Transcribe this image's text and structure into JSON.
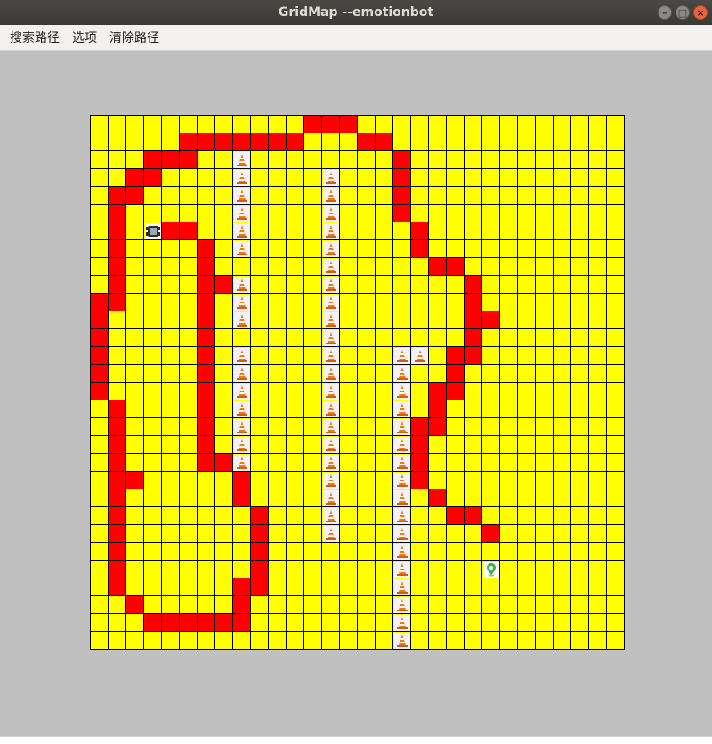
{
  "window": {
    "title": "GridMap --emotionbot"
  },
  "menu": [
    {
      "id": "search",
      "label": "搜索路径"
    },
    {
      "id": "options",
      "label": "选项"
    },
    {
      "id": "clear",
      "label": "清除路径"
    }
  ],
  "colors": {
    "free": "#ffff00",
    "path": "#ff0000",
    "grid_line": "#000000",
    "background": "#c0c0c0"
  },
  "grid": {
    "cols": 30,
    "rows": 30,
    "start": [
      3,
      6
    ],
    "goal": [
      22,
      25
    ],
    "path": [
      [
        0,
        12
      ],
      [
        0,
        13
      ],
      [
        0,
        14
      ],
      [
        1,
        10
      ],
      [
        1,
        11
      ],
      [
        1,
        12
      ],
      [
        1,
        13
      ],
      [
        1,
        14
      ],
      [
        1,
        15
      ],
      [
        1,
        16
      ],
      [
        1,
        17
      ],
      [
        1,
        18
      ],
      [
        1,
        19
      ],
      [
        1,
        20
      ],
      [
        1,
        21
      ],
      [
        1,
        22
      ],
      [
        1,
        23
      ],
      [
        1,
        24
      ],
      [
        1,
        25
      ],
      [
        1,
        26
      ],
      [
        1,
        27
      ],
      [
        1,
        28
      ],
      [
        1,
        29
      ],
      [
        1,
        30
      ],
      [
        1,
        31
      ],
      [
        1,
        32
      ],
      [
        1,
        33
      ],
      [
        1,
        34
      ],
      [
        1,
        35
      ],
      [
        1,
        36
      ],
      [
        1,
        37
      ],
      [
        1,
        38
      ],
      [
        1,
        39
      ],
      [
        1,
        40
      ],
      [
        1,
        41
      ],
      [
        1,
        42
      ],
      [
        1,
        43
      ],
      [
        1,
        44
      ],
      [
        1,
        45
      ],
      [
        1,
        46
      ],
      [
        1,
        47
      ],
      [
        1,
        48
      ],
      [
        1,
        49
      ],
      [
        1,
        50
      ],
      [
        1,
        51
      ],
      [
        1,
        52
      ],
      [
        1,
        53
      ],
      [
        1,
        54
      ],
      [
        1,
        55
      ],
      [
        1,
        56
      ],
      [
        1,
        57
      ],
      [
        1,
        58
      ],
      [
        1,
        59
      ],
      [
        1,
        60
      ],
      [
        1,
        61
      ],
      [
        1,
        62
      ],
      [
        1,
        63
      ],
      [
        1,
        64
      ],
      [
        1,
        65
      ],
      [
        1,
        66
      ],
      [
        1,
        67
      ],
      [
        1,
        68
      ],
      [
        1,
        69
      ],
      [
        1,
        70
      ],
      [
        1,
        71
      ],
      [
        1,
        72
      ],
      [
        1,
        73
      ],
      [
        1,
        74
      ],
      [
        1,
        75
      ],
      [
        1,
        76
      ],
      [
        1,
        77
      ],
      [
        1,
        78
      ],
      [
        1,
        79
      ],
      [
        1,
        80
      ],
      [
        1,
        81
      ],
      [
        1,
        82
      ],
      [
        1,
        83
      ],
      [
        1,
        84
      ],
      [
        1,
        85
      ],
      [
        1,
        86
      ],
      [
        1,
        87
      ],
      [
        1,
        88
      ],
      [
        1,
        89
      ],
      [
        1,
        90
      ],
      [
        1,
        91
      ],
      [
        1,
        92
      ],
      [
        1,
        93
      ],
      [
        1,
        94
      ],
      [
        1,
        95
      ],
      [
        1,
        96
      ],
      [
        1,
        97
      ],
      [
        1,
        98
      ],
      [
        1,
        99
      ],
      [
        1,
        100
      ]
    ],
    "path_cells": [
      [
        12,
        0
      ],
      [
        13,
        0
      ],
      [
        14,
        0
      ],
      [
        5,
        1
      ],
      [
        6,
        1
      ],
      [
        7,
        1
      ],
      [
        8,
        1
      ],
      [
        9,
        1
      ],
      [
        10,
        1
      ],
      [
        11,
        1
      ],
      [
        15,
        1
      ],
      [
        16,
        1
      ],
      [
        3,
        2
      ],
      [
        4,
        2
      ],
      [
        5,
        2
      ],
      [
        17,
        2
      ],
      [
        2,
        3
      ],
      [
        3,
        3
      ],
      [
        17,
        3
      ],
      [
        1,
        4
      ],
      [
        2,
        4
      ],
      [
        17,
        4
      ],
      [
        1,
        5
      ],
      [
        17,
        5
      ],
      [
        1,
        6
      ],
      [
        4,
        6
      ],
      [
        5,
        6
      ],
      [
        18,
        6
      ],
      [
        1,
        7
      ],
      [
        6,
        7
      ],
      [
        18,
        7
      ],
      [
        1,
        8
      ],
      [
        6,
        8
      ],
      [
        19,
        8
      ],
      [
        20,
        8
      ],
      [
        1,
        9
      ],
      [
        6,
        9
      ],
      [
        7,
        9
      ],
      [
        21,
        9
      ],
      [
        0,
        10
      ],
      [
        1,
        10
      ],
      [
        6,
        10
      ],
      [
        21,
        10
      ],
      [
        0,
        11
      ],
      [
        6,
        11
      ],
      [
        21,
        11
      ],
      [
        22,
        11
      ],
      [
        0,
        12
      ],
      [
        6,
        12
      ],
      [
        21,
        12
      ],
      [
        0,
        13
      ],
      [
        6,
        13
      ],
      [
        20,
        13
      ],
      [
        21,
        13
      ],
      [
        0,
        14
      ],
      [
        6,
        14
      ],
      [
        20,
        14
      ],
      [
        0,
        15
      ],
      [
        6,
        15
      ],
      [
        19,
        15
      ],
      [
        20,
        15
      ],
      [
        1,
        16
      ],
      [
        6,
        16
      ],
      [
        19,
        16
      ],
      [
        1,
        17
      ],
      [
        6,
        17
      ],
      [
        18,
        17
      ],
      [
        19,
        17
      ],
      [
        1,
        18
      ],
      [
        6,
        18
      ],
      [
        18,
        18
      ],
      [
        1,
        19
      ],
      [
        6,
        19
      ],
      [
        7,
        19
      ],
      [
        18,
        19
      ],
      [
        1,
        20
      ],
      [
        2,
        20
      ],
      [
        8,
        20
      ],
      [
        18,
        20
      ],
      [
        1,
        21
      ],
      [
        8,
        21
      ],
      [
        19,
        21
      ],
      [
        1,
        22
      ],
      [
        9,
        22
      ],
      [
        20,
        22
      ],
      [
        21,
        22
      ],
      [
        1,
        23
      ],
      [
        9,
        23
      ],
      [
        22,
        23
      ],
      [
        1,
        24
      ],
      [
        9,
        24
      ],
      [
        1,
        25
      ],
      [
        9,
        25
      ],
      [
        1,
        26
      ],
      [
        8,
        26
      ],
      [
        9,
        26
      ],
      [
        2,
        27
      ],
      [
        8,
        27
      ],
      [
        3,
        28
      ],
      [
        4,
        28
      ],
      [
        5,
        28
      ],
      [
        6,
        28
      ],
      [
        7,
        28
      ],
      [
        8,
        28
      ]
    ],
    "obstacles": [
      [
        8,
        2
      ],
      [
        8,
        3
      ],
      [
        8,
        4
      ],
      [
        8,
        5
      ],
      [
        8,
        6
      ],
      [
        8,
        7
      ],
      [
        8,
        9
      ],
      [
        8,
        10
      ],
      [
        8,
        11
      ],
      [
        8,
        13
      ],
      [
        8,
        14
      ],
      [
        8,
        15
      ],
      [
        8,
        16
      ],
      [
        8,
        17
      ],
      [
        8,
        18
      ],
      [
        8,
        19
      ],
      [
        13,
        3
      ],
      [
        13,
        4
      ],
      [
        13,
        5
      ],
      [
        13,
        6
      ],
      [
        13,
        7
      ],
      [
        13,
        8
      ],
      [
        13,
        9
      ],
      [
        13,
        10
      ],
      [
        13,
        11
      ],
      [
        13,
        12
      ],
      [
        13,
        13
      ],
      [
        13,
        14
      ],
      [
        13,
        15
      ],
      [
        13,
        16
      ],
      [
        13,
        17
      ],
      [
        13,
        18
      ],
      [
        13,
        19
      ],
      [
        13,
        20
      ],
      [
        13,
        21
      ],
      [
        13,
        22
      ],
      [
        13,
        23
      ],
      [
        17,
        13
      ],
      [
        18,
        13
      ],
      [
        17,
        14
      ],
      [
        17,
        15
      ],
      [
        17,
        16
      ],
      [
        17,
        17
      ],
      [
        17,
        18
      ],
      [
        17,
        19
      ],
      [
        17,
        20
      ],
      [
        17,
        21
      ],
      [
        17,
        22
      ],
      [
        17,
        23
      ],
      [
        17,
        24
      ],
      [
        17,
        25
      ],
      [
        17,
        26
      ],
      [
        17,
        27
      ],
      [
        17,
        28
      ],
      [
        17,
        29
      ]
    ]
  }
}
